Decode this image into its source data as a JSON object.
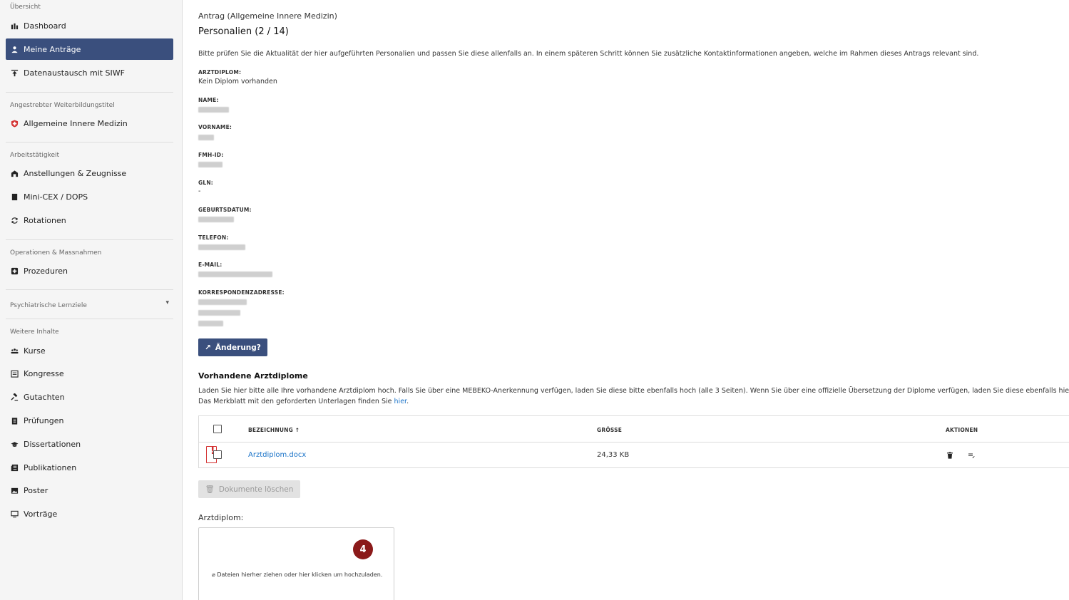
{
  "sidebar": {
    "section_overview": "Übersicht",
    "items_overview": [
      {
        "label": "Dashboard",
        "icon": "bar-chart-icon"
      },
      {
        "label": "Meine Anträge",
        "icon": "user-file-icon",
        "active": true
      },
      {
        "label": "Datenaustausch mit SIWF",
        "icon": "upload-icon"
      }
    ],
    "section_title": "Angestrebter Weiterbildungstitel",
    "title_item": {
      "label": "Allgemeine Innere Medizin",
      "icon": "swiss-flag-icon"
    },
    "section_work": "Arbeitstätigkeit",
    "items_work": [
      {
        "label": "Anstellungen & Zeugnisse",
        "icon": "building-icon"
      },
      {
        "label": "Mini-CEX / DOPS",
        "icon": "book-icon"
      },
      {
        "label": "Rotationen",
        "icon": "rotate-icon"
      }
    ],
    "section_ops": "Operationen & Massnahmen",
    "ops_item": {
      "label": "Prozeduren",
      "icon": "procedure-icon"
    },
    "section_psych": "Psychiatrische Lernziele",
    "section_more": "Weitere Inhalte",
    "items_more": [
      {
        "label": "Kurse",
        "icon": "group-icon"
      },
      {
        "label": "Kongresse",
        "icon": "calendar-icon"
      },
      {
        "label": "Gutachten",
        "icon": "gavel-icon"
      },
      {
        "label": "Prüfungen",
        "icon": "clipboard-icon"
      },
      {
        "label": "Dissertationen",
        "icon": "graduation-cap-icon"
      },
      {
        "label": "Publikationen",
        "icon": "newspaper-icon"
      },
      {
        "label": "Poster",
        "icon": "image-icon"
      },
      {
        "label": "Vorträge",
        "icon": "monitor-icon"
      }
    ]
  },
  "main": {
    "breadcrumb": "Antrag (Allgemeine Innere Medizin)",
    "title": "Personalien (2 / 14)",
    "intro": "Bitte prüfen Sie die Aktualität der hier aufgeführten Personalien und passen Sie diese allenfalls an. In einem späteren Schritt können Sie zusätzliche Kontaktinformationen angeben, welche im Rahmen dieses Antrags relevant sind.",
    "fields": {
      "arztdiplom_label": "ARZTDIPLOM:",
      "arztdiplom_value": "Kein Diplom vorhanden",
      "name_label": "NAME:",
      "vorname_label": "VORNAME:",
      "fmh_label": "FMH-ID:",
      "gln_label": "GLN:",
      "gln_value": "-",
      "geburt_label": "GEBURTSDATUM:",
      "telefon_label": "TELEFON:",
      "email_label": "E-MAIL:",
      "adresse_label": "KORRESPONDENZADRESSE:"
    },
    "change_button": "Änderung?",
    "diplomas_title": "Vorhandene Arztdiplome",
    "diplomas_text_1": "Laden Sie hier bitte alle Ihre vorhandene Arztdiplom hoch. Falls Sie über eine MEBEKO-Anerkennung verfügen, laden Sie diese bitte ebenfalls hoch (alle 3 Seiten). Wenn Sie über eine offizielle Übersetzung der Diplome verfügen, laden Sie diese ebenfalls hier hoch.",
    "diplomas_text_2": "Das Merkblatt mit den geforderten Unterlagen finden Sie",
    "diplomas_link": "hier",
    "table": {
      "col_name": "BEZEICHNUNG",
      "col_size": "GRÖSSE",
      "col_actions": "AKTIONEN",
      "rows": [
        {
          "name": "Arztdiplom.docx",
          "size": "24,33 KB"
        }
      ]
    },
    "delete_button": "Dokumente löschen",
    "upload_label": "Arztdiplom:",
    "upload_hint": "Dateien hierher ziehen oder hier klicken um hochzuladen.",
    "step_badge": "4"
  }
}
